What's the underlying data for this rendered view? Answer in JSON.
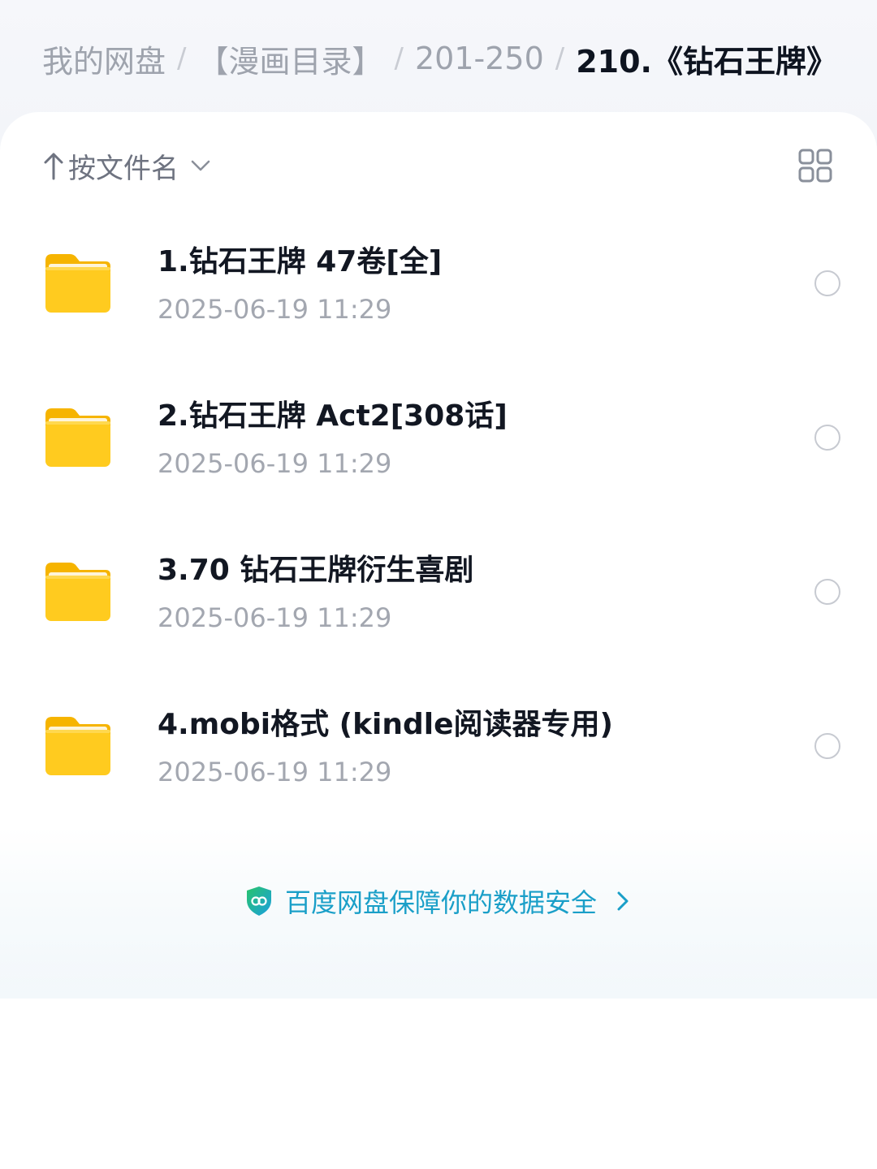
{
  "breadcrumb": {
    "items": [
      "我的网盘",
      "【漫画目录】",
      "201-250"
    ],
    "current": "210.《钻石王牌》",
    "separator": "/"
  },
  "sort": {
    "label": "按文件名",
    "direction_icon": "arrow-up-icon",
    "dropdown_icon": "chevron-down-icon"
  },
  "view_toggle": {
    "icon": "grid-view-icon"
  },
  "files": [
    {
      "name": "1.钻石王牌 47卷[全]",
      "date": "2025-06-19 11:29",
      "icon": "folder-icon"
    },
    {
      "name": "2.钻石王牌 Act2[308话]",
      "date": "2025-06-19 11:29",
      "icon": "folder-icon"
    },
    {
      "name": "3.70 钻石王牌衍生喜剧",
      "date": "2025-06-19 11:29",
      "icon": "folder-icon"
    },
    {
      "name": "4.mobi格式 (kindle阅读器专用)",
      "date": "2025-06-19 11:29",
      "icon": "folder-icon"
    }
  ],
  "security_banner": {
    "text": "百度网盘保障你的数据安全",
    "icon": "shield-icon",
    "color": "#1a9fc8"
  },
  "colors": {
    "folder": "#ffcb1f",
    "text_primary": "#121722",
    "text_secondary": "#a3a7b0"
  }
}
